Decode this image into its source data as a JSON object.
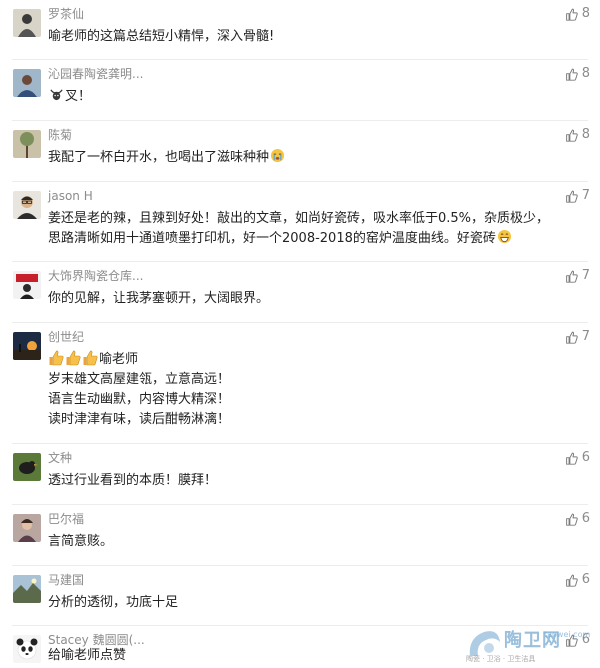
{
  "comments": [
    {
      "author": "罗茶仙",
      "likes": "8",
      "lines": [
        "喻老师的这篇总结短小精悍，深入骨髓!"
      ],
      "avatar": "avatar-ink-portrait"
    },
    {
      "author": "沁园春陶瓷龚明...",
      "likes": "8",
      "lines": [
        "叉！"
      ],
      "avatar": "avatar-person"
    },
    {
      "author": "陈菊",
      "likes": "8",
      "lines": [
        "我配了一杯白开水，也喝出了滋味种种"
      ],
      "avatar": "avatar-tree"
    },
    {
      "author": "jason H",
      "likes": "7",
      "lines": [
        "姜还是老的辣，且辣到好处！敲出的文章，如尚好瓷砖，吸水率低于0.5%，杂质极少，",
        "思路清晰如用十通道喷墨打印机，好一个2008-2018的窑炉温度曲线。好瓷砖"
      ],
      "avatar": "avatar-man-glasses"
    },
    {
      "author": "大饰界陶瓷仓库...",
      "likes": "7",
      "lines": [
        "你的见解，让我茅塞顿开，大阔眼界。"
      ],
      "avatar": "avatar-red-poster"
    },
    {
      "author": "创世纪",
      "likes": "7",
      "lines": [
        "喻老师",
        "岁末雄文高屋建瓴，立意高远！",
        "语言生动幽默，内容博大精深！",
        "读时津津有味，读后酣畅淋漓！"
      ],
      "avatar": "avatar-sunset"
    },
    {
      "author": "文种",
      "likes": "6",
      "lines": [
        "透过行业看到的本质！膜拜！"
      ],
      "avatar": "avatar-bird"
    },
    {
      "author": "巴尔福",
      "likes": "6",
      "lines": [
        "言简意赅。"
      ],
      "avatar": "avatar-portrait"
    },
    {
      "author": "马建国",
      "likes": "6",
      "lines": [
        "分析的透彻，功底十足"
      ],
      "avatar": "avatar-landscape"
    },
    {
      "author": "Stacey 魏圆圆(...",
      "likes": "6",
      "lines": [
        "给喻老师点赞"
      ],
      "avatar": "avatar-panda"
    }
  ],
  "watermark": {
    "brand": "陶卫网",
    "domain": "taowei.com",
    "tagline": "陶瓷 · 卫浴 · 卫生洁具"
  },
  "colors": {
    "text": "#222222",
    "meta": "#8c8c8c",
    "separator": "#ececec"
  }
}
